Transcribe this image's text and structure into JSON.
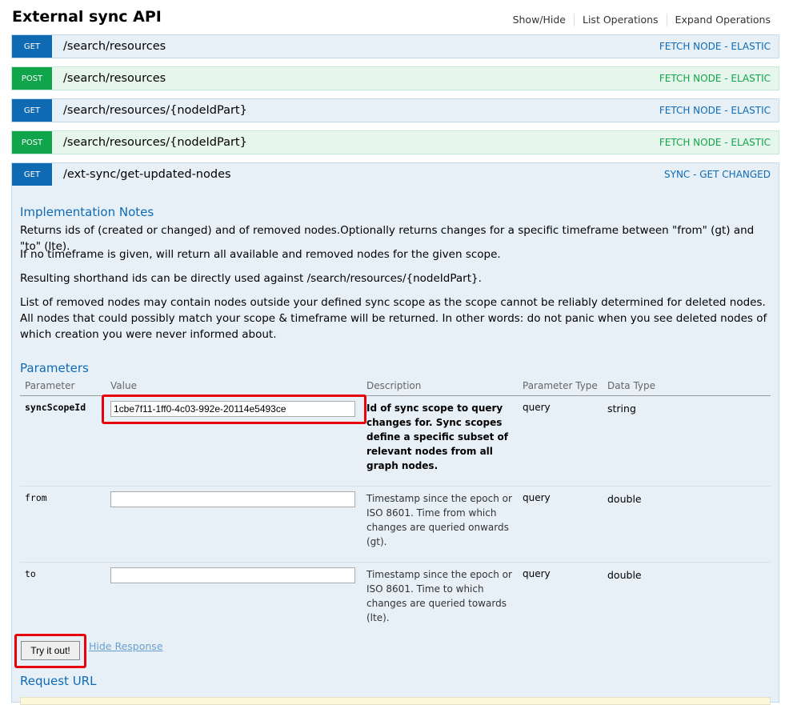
{
  "header": {
    "title": "External sync API",
    "links": [
      "Show/Hide",
      "List Operations",
      "Expand Operations"
    ]
  },
  "operations": [
    {
      "method": "GET",
      "path": "/search/resources",
      "tag": "FETCH NODE - ELASTIC"
    },
    {
      "method": "POST",
      "path": "/search/resources",
      "tag": "FETCH NODE - ELASTIC"
    },
    {
      "method": "GET",
      "path": "/search/resources/{nodeIdPart}",
      "tag": "FETCH NODE - ELASTIC"
    },
    {
      "method": "POST",
      "path": "/search/resources/{nodeIdPart}",
      "tag": "FETCH NODE - ELASTIC"
    },
    {
      "method": "GET",
      "path": "/ext-sync/get-updated-nodes",
      "tag": "SYNC - GET CHANGED"
    }
  ],
  "details": {
    "impl_heading": "Implementation Notes",
    "notes": [
      "Returns ids of (created or changed) and of removed nodes.Optionally returns changes for a specific timeframe between \"from\" (gt) and \"to\" (lte).",
      "If no timeframe is given, will return all available and removed nodes for the given scope.",
      "Resulting shorthand ids can be directly used against /search/resources/{nodeIdPart}.",
      "List of removed nodes may contain nodes outside your defined sync scope as the scope cannot be reliably determined for deleted nodes. All nodes that could possibly match your scope & timeframe will be returned. In other words: do not panic when you see deleted nodes of which creation you were never informed about."
    ],
    "params_heading": "Parameters",
    "columns": [
      "Parameter",
      "Value",
      "Description",
      "Parameter Type",
      "Data Type"
    ],
    "params": [
      {
        "name": "syncScopeId",
        "value": "1cbe7f11-1ff0-4c03-992e-20114e5493ce",
        "description": "Id of sync scope to query changes for. Sync scopes define a specific subset of relevant nodes from all graph nodes.",
        "param_type": "query",
        "data_type": "string"
      },
      {
        "name": "from",
        "value": "",
        "description": "Timestamp since the epoch or ISO 8601. Time from which changes are queried onwards (gt).",
        "param_type": "query",
        "data_type": "double"
      },
      {
        "name": "to",
        "value": "",
        "description": "Timestamp since the epoch or ISO 8601. Time to which changes are queried towards (lte).",
        "param_type": "query",
        "data_type": "double"
      }
    ],
    "try_button": "Try it out!",
    "hide_response": "Hide Response",
    "request_url_heading": "Request URL"
  }
}
